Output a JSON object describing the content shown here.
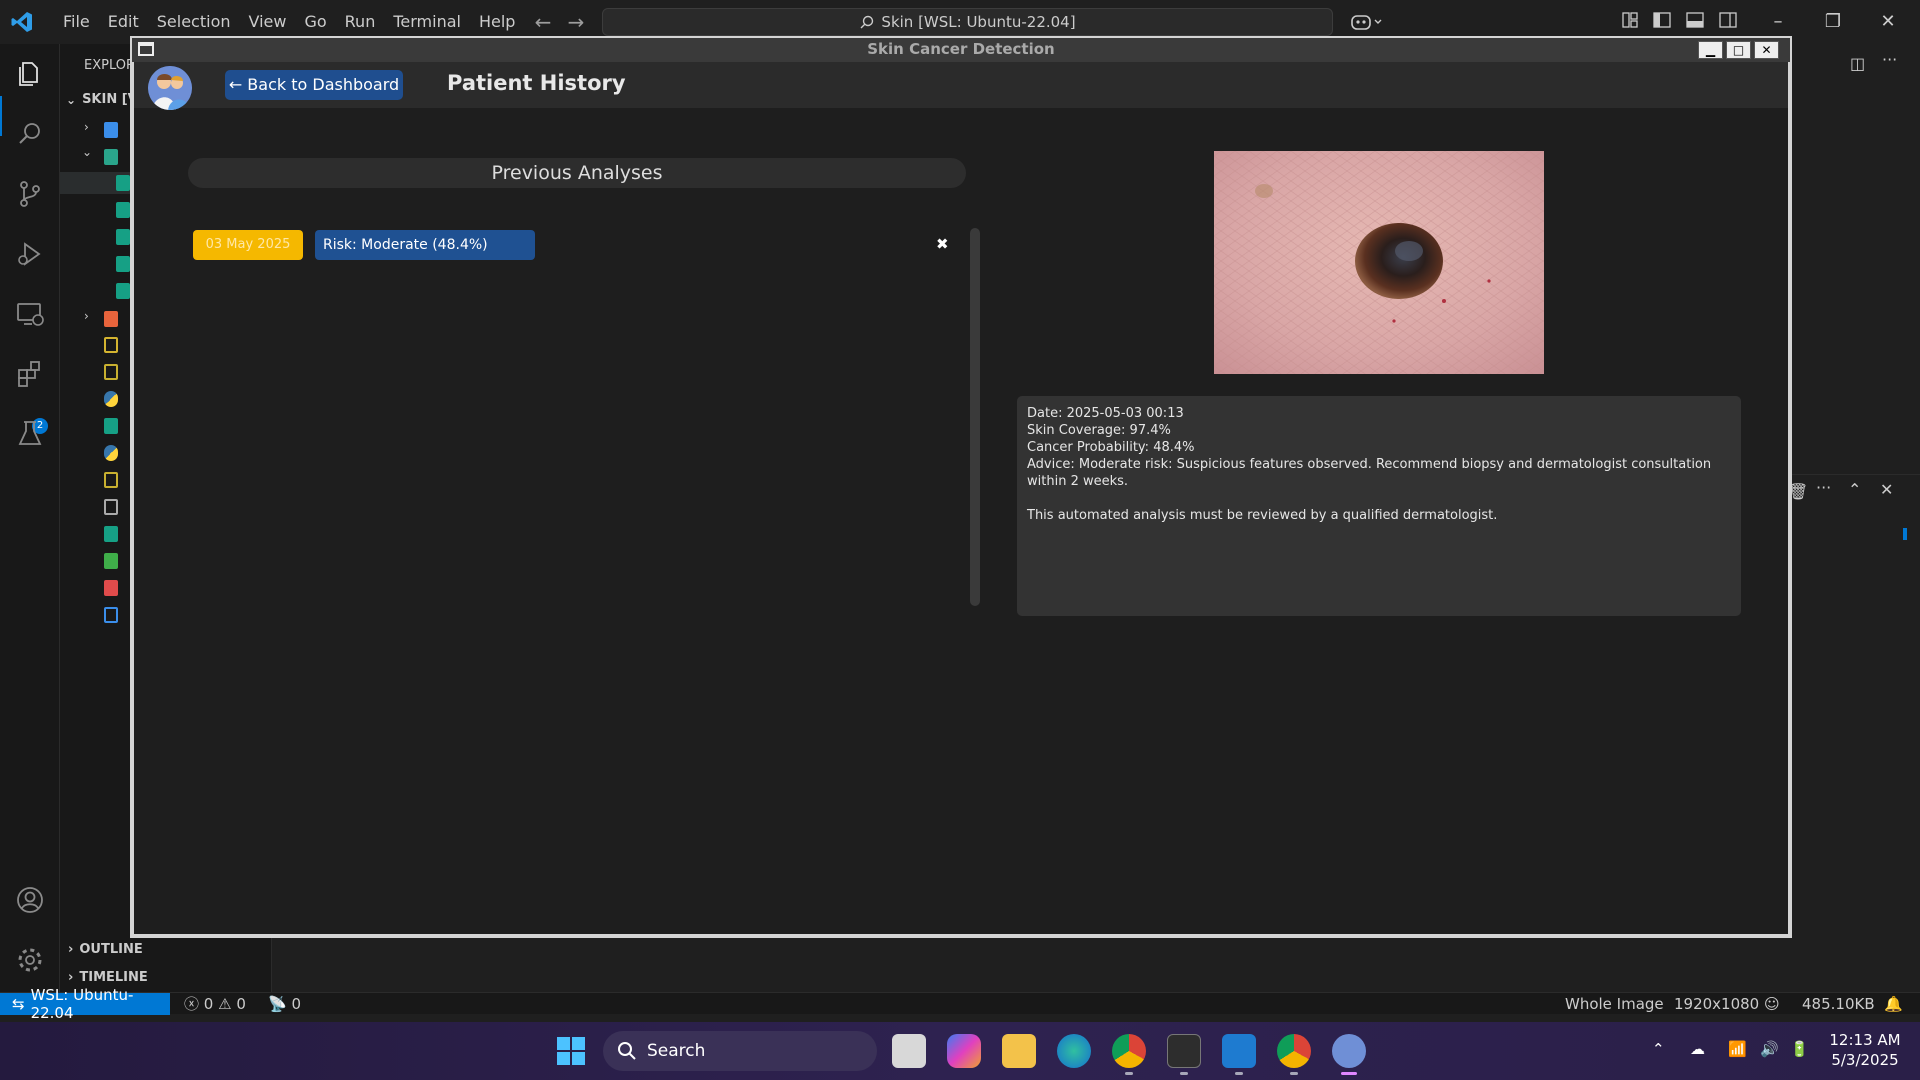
{
  "vscode": {
    "menu": [
      "File",
      "Edit",
      "Selection",
      "View",
      "Go",
      "Run",
      "Terminal",
      "Help"
    ],
    "command_center": "Skin [WSL: Ubuntu-22.04]",
    "explorer_header": "EXPLOR",
    "workspace_label": "SKIN [V",
    "outline_label": "OUTLINE",
    "timeline_label": "TIMELINE",
    "extensions_badge": "2"
  },
  "statusbar": {
    "remote": "WSL: Ubuntu-22.04",
    "errors": "0",
    "warnings": "0",
    "ports": "0",
    "image_mode": "Whole Image",
    "image_size": "1920x1080",
    "file_size": "485.10KB"
  },
  "app": {
    "window_title": "Skin Cancer Detection",
    "back_label": "← Back to Dashboard",
    "page_title": "Patient History",
    "previous_title": "Previous Analyses",
    "entry": {
      "date": "03 May 2025",
      "risk": "Risk: Moderate (48.4%)",
      "delete": "✖"
    },
    "details": {
      "date": "Date: 2025-05-03 00:13",
      "coverage": "Skin Coverage: 97.4%",
      "probability": "Cancer Probability: 48.4%",
      "advice": "Advice: Moderate risk: Suspicious features observed. Recommend biopsy and dermatologist consultation within 2 weeks.",
      "disclaimer": "This automated analysis must be reviewed by a qualified dermatologist."
    }
  },
  "taskbar": {
    "search_label": "Search",
    "time": "12:13 AM",
    "date": "5/3/2025"
  }
}
